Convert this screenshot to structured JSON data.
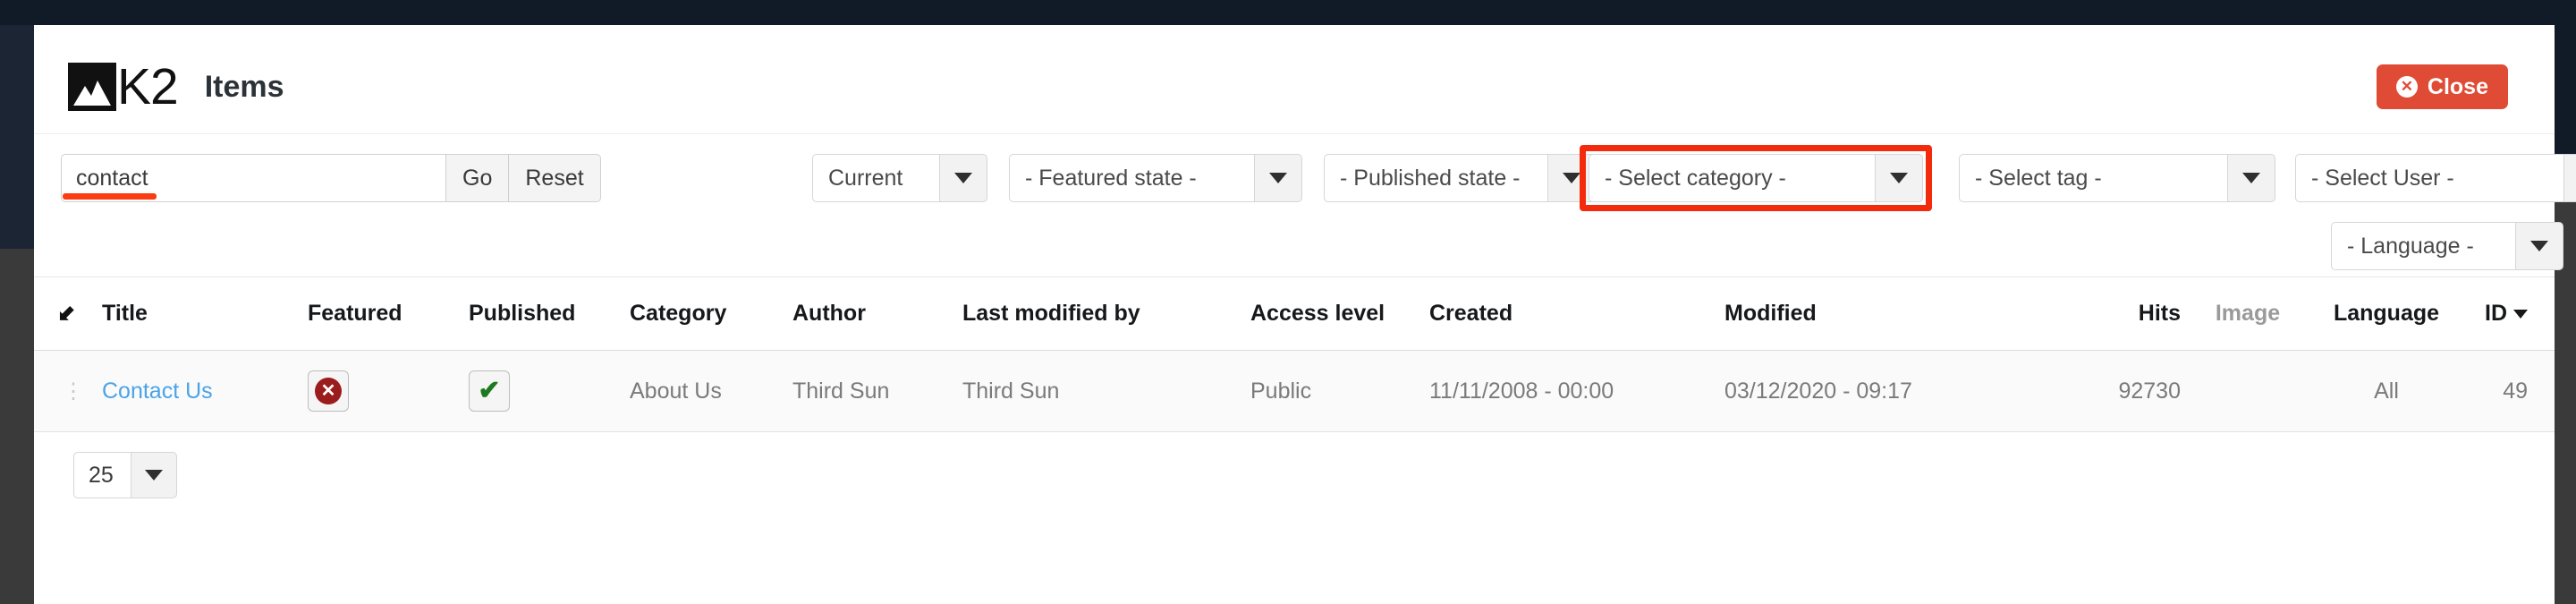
{
  "header": {
    "logo_text": "K2",
    "logo_icon": "mountain-icon",
    "title": "Items",
    "close_label": "Close",
    "close_icon": "close-circle-icon",
    "close_color": "#e04b36"
  },
  "filters": {
    "search": {
      "value": "contact",
      "placeholder": ""
    },
    "go_label": "Go",
    "reset_label": "Reset",
    "selects": [
      {
        "name": "state",
        "value": "Current"
      },
      {
        "name": "featured-state",
        "value": "- Featured state -"
      },
      {
        "name": "published-state",
        "value": "- Published state -"
      },
      {
        "name": "category",
        "value": "- Select category -",
        "highlighted": true
      },
      {
        "name": "tag",
        "value": "- Select tag -"
      },
      {
        "name": "user",
        "value": "- Select User -"
      },
      {
        "name": "language",
        "value": "- Language -"
      }
    ],
    "highlight_color": "#f42a0c"
  },
  "table": {
    "columns": [
      {
        "key": "sort",
        "label": "",
        "icon": "sort-updown-icon"
      },
      {
        "key": "title",
        "label": "Title"
      },
      {
        "key": "featured",
        "label": "Featured"
      },
      {
        "key": "published",
        "label": "Published"
      },
      {
        "key": "category",
        "label": "Category"
      },
      {
        "key": "author",
        "label": "Author"
      },
      {
        "key": "modified_by",
        "label": "Last modified by"
      },
      {
        "key": "access",
        "label": "Access level"
      },
      {
        "key": "created",
        "label": "Created"
      },
      {
        "key": "modified",
        "label": "Modified"
      },
      {
        "key": "hits",
        "label": "Hits"
      },
      {
        "key": "image",
        "label": "Image",
        "muted": true
      },
      {
        "key": "language",
        "label": "Language"
      },
      {
        "key": "id",
        "label": "ID",
        "sorted": true
      }
    ],
    "rows": [
      {
        "handle_icon": "drag-handle-icon",
        "title": "Contact Us",
        "featured": {
          "state": "no",
          "icon": "cross-circle-icon"
        },
        "published": {
          "state": "yes",
          "icon": "check-icon"
        },
        "category": "About Us",
        "author": "Third Sun",
        "modified_by": "Third Sun",
        "access": "Public",
        "created": "11/11/2008 - 00:00",
        "modified": "03/12/2020 - 09:17",
        "hits": "92730",
        "image": "",
        "language": "All",
        "id": "49"
      }
    ]
  },
  "footer": {
    "limit_value": "25"
  }
}
